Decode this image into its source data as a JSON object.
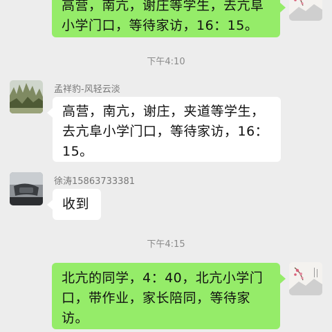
{
  "messages": [
    {
      "direction": "out",
      "text": "高营，南亢，谢庄等学生，去亢阜小学门口，等待家访，16：15。"
    },
    {
      "type": "timestamp",
      "text": "下午4:10"
    },
    {
      "direction": "in",
      "sender": "孟祥豹-风轻云淡",
      "text": "高营，南亢，谢庄，夹道等学生，去亢阜小学门口，等待家访，16：15。"
    },
    {
      "direction": "in",
      "sender": "徐涛15863733381",
      "text": "收到"
    },
    {
      "type": "timestamp",
      "text": "下午4:15"
    },
    {
      "direction": "out",
      "text": "北亢的同学，4：40，北亢小学门口，带作业，家长陪同，等待家访。"
    }
  ],
  "colors": {
    "background": "#ededed",
    "outgoing_bubble": "#95ec69",
    "incoming_bubble": "#ffffff",
    "timestamp_text": "#8a8a8a",
    "sender_text": "#777777"
  }
}
